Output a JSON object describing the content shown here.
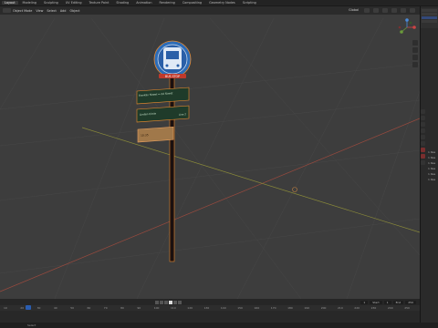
{
  "workspace_tabs": [
    "Layout",
    "Modeling",
    "Sculpting",
    "UV Editing",
    "Texture Paint",
    "Shading",
    "Animation",
    "Rendering",
    "Compositing",
    "Geometry Nodes",
    "Scripting"
  ],
  "active_tab_index": 0,
  "viewport": {
    "mode_label": "Object Mode",
    "view_label": "View",
    "select_label": "Select",
    "add_label": "Add",
    "object_label": "Object",
    "transform_label": "Global"
  },
  "scene": {
    "sign_top_text": "BUS STOP",
    "board1_text": "Franklin Street ↔ 24 Street",
    "board2_text": "Linden Circle",
    "board2_right": "Line 2",
    "board3_text": "10:35",
    "colors": {
      "sign_blue": "#2c6cb8",
      "sign_red": "#c0392b",
      "board_green": "#1f3b2a",
      "board_orange": "#a0784a",
      "pole": "#1b1010",
      "selection_orange": "#e88a2f"
    }
  },
  "outliner": {
    "rows": [
      "Scene Collection",
      "Collection",
      "BusStop"
    ]
  },
  "properties": {
    "items": [
      "1 Res",
      "1 Res",
      "1 Res",
      "1 Res",
      "1 Res",
      "1 Res"
    ]
  },
  "timeline": {
    "start_label": "Start",
    "start_value": "1",
    "end_label": "End",
    "end_value": "250",
    "current_frame": "1",
    "ruler": [
      "10",
      "20",
      "30",
      "40",
      "50",
      "60",
      "70",
      "80",
      "90",
      "100",
      "110",
      "120",
      "130",
      "140",
      "150",
      "160",
      "170",
      "180",
      "190",
      "200",
      "210",
      "220",
      "230",
      "240",
      "250"
    ]
  },
  "status": {
    "text": "Select"
  }
}
